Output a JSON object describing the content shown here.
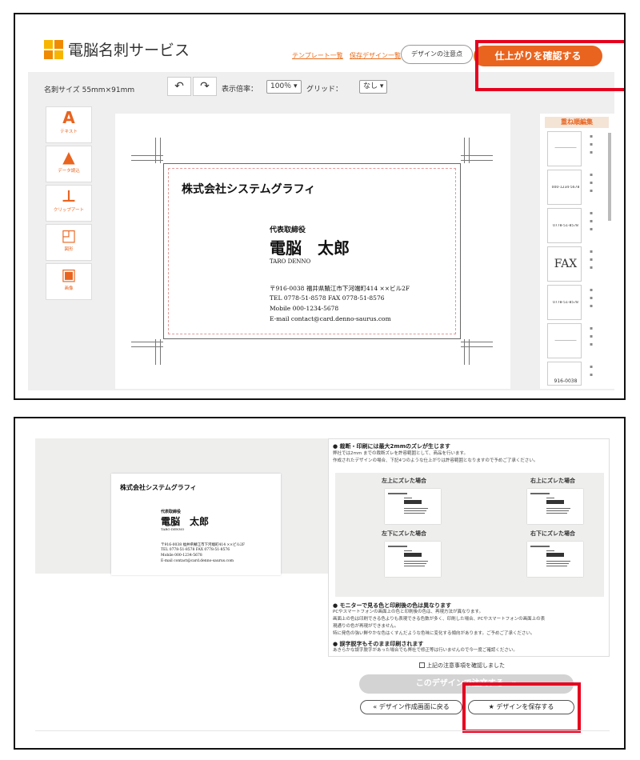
{
  "panel1": {
    "app_title": "電脳名刺サービス",
    "links": {
      "templates": "テンプレート一覧",
      "saved": "保存デザイン一覧"
    },
    "notice_button": "デザインの注意点",
    "confirm_button": "仕上がりを確認する",
    "toolbar": {
      "card_size": "名刺サイズ 55mm×91mm",
      "undo_icon": "↶",
      "redo_icon": "↷",
      "zoom_label": "表示倍率：",
      "zoom_value": "100％",
      "grid_label": "グリッド：",
      "grid_value": "なし"
    },
    "tools": [
      {
        "icon": "A",
        "label": "テキスト"
      },
      {
        "icon": "▲",
        "label": "データ読込"
      },
      {
        "icon": "⊥",
        "label": "クリップアート"
      },
      {
        "icon": "◰",
        "label": "図形"
      },
      {
        "icon": "▣",
        "label": "画像"
      }
    ],
    "card": {
      "company": "株式会社システムグラフィ",
      "title": "代表取締役",
      "name": "電脳　太郎",
      "name_en": "TARO DENNO",
      "address": "〒916-0038 福井県鯖江市下河端町414 ××ビル2F",
      "tel_fax": "TEL 0778-51-8578  FAX 0778-51-8576",
      "mobile": "Mobile  000-1234-5678",
      "email": "E-mail  contact@card.denno-saurus.com"
    },
    "layers_title": "重ね順編集",
    "layers": [
      {
        "preview": "――――――"
      },
      {
        "preview": "000-1234-5678"
      },
      {
        "preview": "0778-51-8578"
      },
      {
        "preview": "FAX"
      },
      {
        "preview": "0778-51-8578"
      },
      {
        "preview": "――――――"
      },
      {
        "preview": "916-0038"
      }
    ],
    "layer_controls": {
      "lock": "🔒",
      "copy": "❐",
      "trash": "🗑"
    }
  },
  "panel2": {
    "preview_card": {
      "company": "株式会社システムグラフィ",
      "title": "代表取締役",
      "name": "電脳　太郎",
      "name_en": "TARO DENNO",
      "address": "〒916-0038 福井県鯖江市下河端町414 ××ビル2F",
      "tel_fax": "TEL 0778-51-8578  FAX 0778-51-8576",
      "mobile": "Mobile  000-1234-5678",
      "email": "E-mail  contact@card.denno-saurus.com"
    },
    "notes": {
      "h1": "● 裁断・印刷には最大2mmのズレが生じます",
      "t1a": "弊社では2mm までの裁断ズレを許容範囲として、商品を行います。",
      "t1b": "作成されたデザインの場合、下記4つのような仕上がりは許容範囲となりますので予めご了承ください。",
      "shift_tl": "左上にズレた場合",
      "shift_tr": "右上にズレた場合",
      "shift_bl": "左下にズレた場合",
      "shift_br": "右下にズレた場合",
      "h2": "● モニターで見る色と印刷後の色は異なります",
      "t2a": "PCやスマートフォンの画面上の色と印刷後の色は、再現方法が異なります。",
      "t2b": "画面上の色は印刷できる色よりも表現できる色数が多く、印刷した場合、PCやスマートフォンの画面上の表",
      "t2c": "現通りの色が再現ができません。",
      "t2d": "特に発色の強い鮮やかな色はくすんだような色味に変化する傾向があります。ご予めご了承ください。",
      "h3": "● 誤字脱字もそのまま印刷されます",
      "t3a": "あきらかな誤字脱字があった場合でも弊社で修正等は行いませんので今一度ご確認ください。"
    },
    "confirm_check": "上記の注意事項を確認しました",
    "order_button": "このデザインで注文する　»",
    "back_button": "« デザイン作成画面に戻る",
    "save_button": "★ デザインを保存する"
  },
  "colors": {
    "accent": "#e8641f",
    "highlight": "#e6001f"
  }
}
